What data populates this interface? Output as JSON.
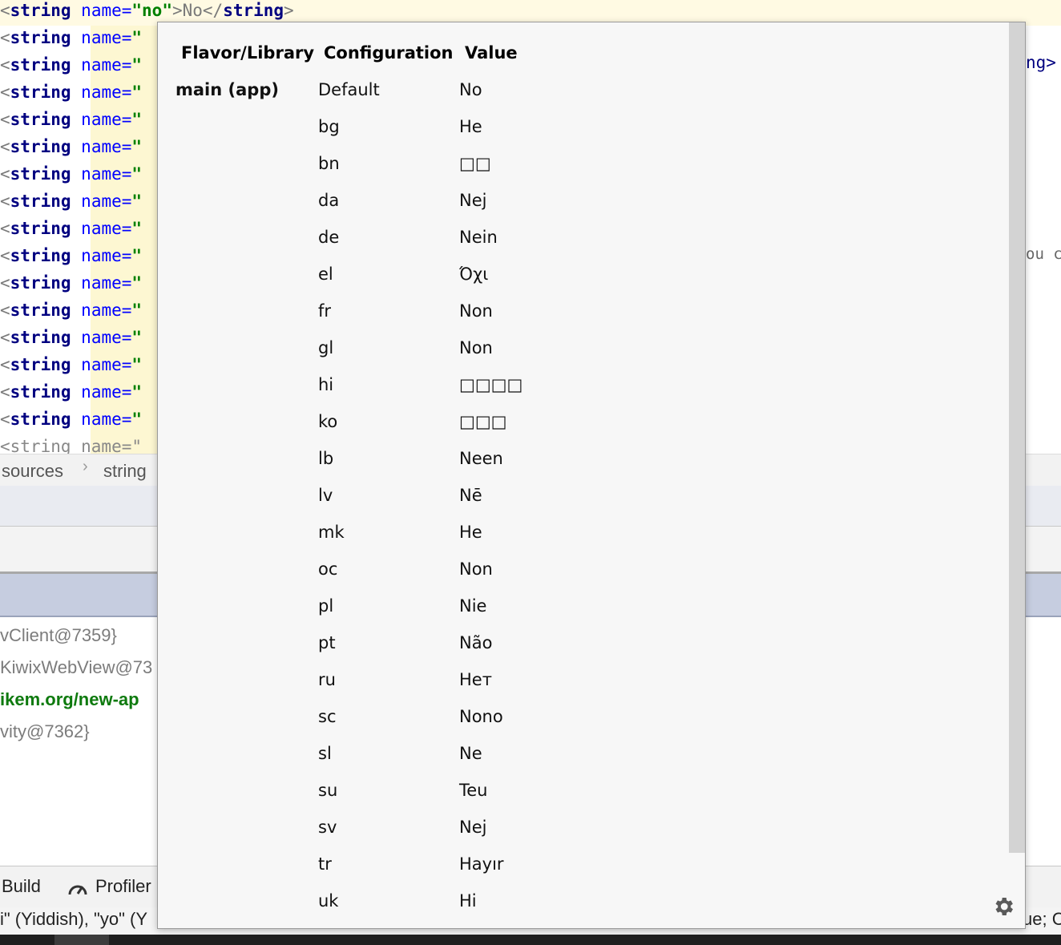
{
  "editor": {
    "first_line": {
      "open": "<",
      "tag": "string",
      "attr": "name=",
      "val": "\"no\"",
      "mid": ">No</",
      "tag2": "string",
      "close": ">"
    },
    "line_prefix": {
      "open": "<",
      "tag": "string",
      "attr": "name=",
      "quote": "\""
    },
    "partial_last": "<string name=\"",
    "right_peek_1": "ng>",
    "right_peek_2": "ou c"
  },
  "breadcrumb": {
    "items": [
      "sources",
      "string"
    ]
  },
  "debug_lines": [
    "vClient@7359}",
    "KiwixWebView@73",
    "ikem.org/new-ap",
    "vity@7362}"
  ],
  "toolwindows": {
    "build": "Build",
    "profiler": "Profiler"
  },
  "status": {
    "left": "i\" (Yiddish), \"yo\" (Y",
    "right": "ue; C"
  },
  "popup": {
    "headers": {
      "flavor": "Flavor/Library",
      "config": "Configuration",
      "value": "Value"
    },
    "rows": [
      {
        "flavor": "main (app)",
        "config": "Default",
        "value": "No"
      },
      {
        "flavor": "",
        "config": "bg",
        "value": "He"
      },
      {
        "flavor": "",
        "config": "bn",
        "value": "□□"
      },
      {
        "flavor": "",
        "config": "da",
        "value": "Nej"
      },
      {
        "flavor": "",
        "config": "de",
        "value": "Nein"
      },
      {
        "flavor": "",
        "config": "el",
        "value": "Όχι"
      },
      {
        "flavor": "",
        "config": "fr",
        "value": "Non"
      },
      {
        "flavor": "",
        "config": "gl",
        "value": "Non"
      },
      {
        "flavor": "",
        "config": "hi",
        "value": "□□□□"
      },
      {
        "flavor": "",
        "config": "ko",
        "value": "□□□"
      },
      {
        "flavor": "",
        "config": "lb",
        "value": "Neen"
      },
      {
        "flavor": "",
        "config": "lv",
        "value": "Nē"
      },
      {
        "flavor": "",
        "config": "mk",
        "value": "He"
      },
      {
        "flavor": "",
        "config": "oc",
        "value": "Non"
      },
      {
        "flavor": "",
        "config": "pl",
        "value": "Nie"
      },
      {
        "flavor": "",
        "config": "pt",
        "value": "Não"
      },
      {
        "flavor": "",
        "config": "ru",
        "value": "Нет"
      },
      {
        "flavor": "",
        "config": "sc",
        "value": "Nono"
      },
      {
        "flavor": "",
        "config": "sl",
        "value": "Ne"
      },
      {
        "flavor": "",
        "config": "su",
        "value": "Teu"
      },
      {
        "flavor": "",
        "config": "sv",
        "value": "Nej"
      },
      {
        "flavor": "",
        "config": "tr",
        "value": "Hayır"
      },
      {
        "flavor": "",
        "config": "uk",
        "value": "Hi"
      }
    ],
    "settings_icon": "gear-icon"
  }
}
